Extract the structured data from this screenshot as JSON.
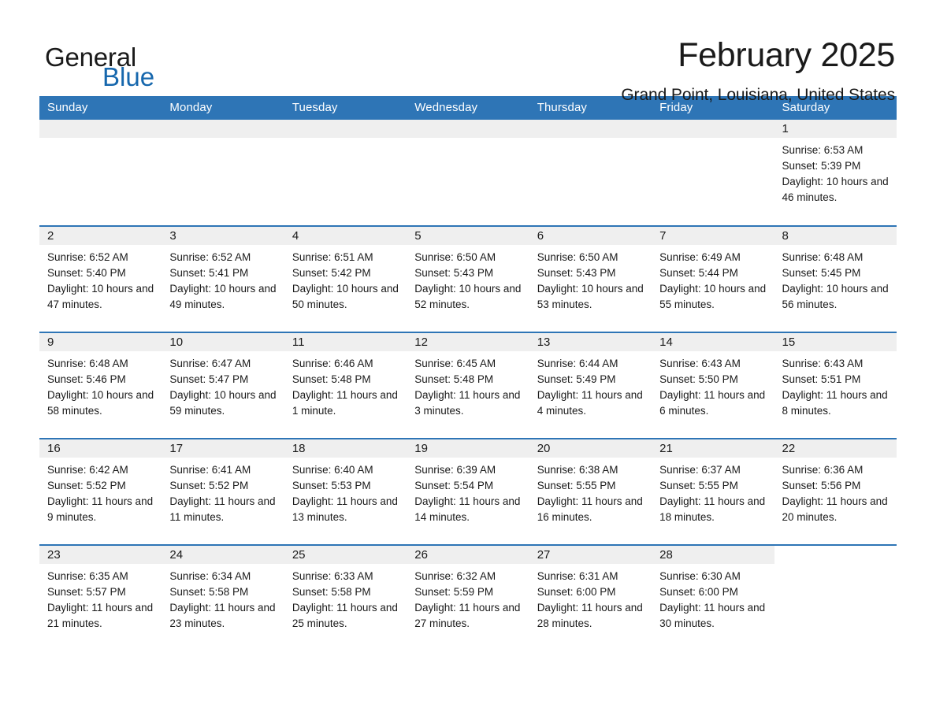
{
  "brand": {
    "name_part1": "General",
    "name_part2": "Blue",
    "logo_icon": "blue-triangle-flag",
    "color_black": "#1a1a1a",
    "color_blue": "#1667ad"
  },
  "header": {
    "title": "February 2025",
    "subtitle": "Grand Point, Louisiana, United States"
  },
  "theme": {
    "header_blue": "#2e75b6",
    "daynum_gray": "#efefef",
    "text": "#1a1a1a"
  },
  "weekday_headers": [
    "Sunday",
    "Monday",
    "Tuesday",
    "Wednesday",
    "Thursday",
    "Friday",
    "Saturday"
  ],
  "labels": {
    "sunrise_prefix": "Sunrise:",
    "sunset_prefix": "Sunset:",
    "daylight_prefix": "Daylight:"
  },
  "weeks": [
    [
      {
        "day": "",
        "blank": true
      },
      {
        "day": "",
        "blank": true
      },
      {
        "day": "",
        "blank": true
      },
      {
        "day": "",
        "blank": true
      },
      {
        "day": "",
        "blank": true
      },
      {
        "day": "",
        "blank": true
      },
      {
        "day": "1",
        "sunrise": "Sunrise: 6:53 AM",
        "sunset": "Sunset: 5:39 PM",
        "daylight": "Daylight: 10 hours and 46 minutes."
      }
    ],
    [
      {
        "day": "2",
        "sunrise": "Sunrise: 6:52 AM",
        "sunset": "Sunset: 5:40 PM",
        "daylight": "Daylight: 10 hours and 47 minutes."
      },
      {
        "day": "3",
        "sunrise": "Sunrise: 6:52 AM",
        "sunset": "Sunset: 5:41 PM",
        "daylight": "Daylight: 10 hours and 49 minutes."
      },
      {
        "day": "4",
        "sunrise": "Sunrise: 6:51 AM",
        "sunset": "Sunset: 5:42 PM",
        "daylight": "Daylight: 10 hours and 50 minutes."
      },
      {
        "day": "5",
        "sunrise": "Sunrise: 6:50 AM",
        "sunset": "Sunset: 5:43 PM",
        "daylight": "Daylight: 10 hours and 52 minutes."
      },
      {
        "day": "6",
        "sunrise": "Sunrise: 6:50 AM",
        "sunset": "Sunset: 5:43 PM",
        "daylight": "Daylight: 10 hours and 53 minutes."
      },
      {
        "day": "7",
        "sunrise": "Sunrise: 6:49 AM",
        "sunset": "Sunset: 5:44 PM",
        "daylight": "Daylight: 10 hours and 55 minutes."
      },
      {
        "day": "8",
        "sunrise": "Sunrise: 6:48 AM",
        "sunset": "Sunset: 5:45 PM",
        "daylight": "Daylight: 10 hours and 56 minutes."
      }
    ],
    [
      {
        "day": "9",
        "sunrise": "Sunrise: 6:48 AM",
        "sunset": "Sunset: 5:46 PM",
        "daylight": "Daylight: 10 hours and 58 minutes."
      },
      {
        "day": "10",
        "sunrise": "Sunrise: 6:47 AM",
        "sunset": "Sunset: 5:47 PM",
        "daylight": "Daylight: 10 hours and 59 minutes."
      },
      {
        "day": "11",
        "sunrise": "Sunrise: 6:46 AM",
        "sunset": "Sunset: 5:48 PM",
        "daylight": "Daylight: 11 hours and 1 minute."
      },
      {
        "day": "12",
        "sunrise": "Sunrise: 6:45 AM",
        "sunset": "Sunset: 5:48 PM",
        "daylight": "Daylight: 11 hours and 3 minutes."
      },
      {
        "day": "13",
        "sunrise": "Sunrise: 6:44 AM",
        "sunset": "Sunset: 5:49 PM",
        "daylight": "Daylight: 11 hours and 4 minutes."
      },
      {
        "day": "14",
        "sunrise": "Sunrise: 6:43 AM",
        "sunset": "Sunset: 5:50 PM",
        "daylight": "Daylight: 11 hours and 6 minutes."
      },
      {
        "day": "15",
        "sunrise": "Sunrise: 6:43 AM",
        "sunset": "Sunset: 5:51 PM",
        "daylight": "Daylight: 11 hours and 8 minutes."
      }
    ],
    [
      {
        "day": "16",
        "sunrise": "Sunrise: 6:42 AM",
        "sunset": "Sunset: 5:52 PM",
        "daylight": "Daylight: 11 hours and 9 minutes."
      },
      {
        "day": "17",
        "sunrise": "Sunrise: 6:41 AM",
        "sunset": "Sunset: 5:52 PM",
        "daylight": "Daylight: 11 hours and 11 minutes."
      },
      {
        "day": "18",
        "sunrise": "Sunrise: 6:40 AM",
        "sunset": "Sunset: 5:53 PM",
        "daylight": "Daylight: 11 hours and 13 minutes."
      },
      {
        "day": "19",
        "sunrise": "Sunrise: 6:39 AM",
        "sunset": "Sunset: 5:54 PM",
        "daylight": "Daylight: 11 hours and 14 minutes."
      },
      {
        "day": "20",
        "sunrise": "Sunrise: 6:38 AM",
        "sunset": "Sunset: 5:55 PM",
        "daylight": "Daylight: 11 hours and 16 minutes."
      },
      {
        "day": "21",
        "sunrise": "Sunrise: 6:37 AM",
        "sunset": "Sunset: 5:55 PM",
        "daylight": "Daylight: 11 hours and 18 minutes."
      },
      {
        "day": "22",
        "sunrise": "Sunrise: 6:36 AM",
        "sunset": "Sunset: 5:56 PM",
        "daylight": "Daylight: 11 hours and 20 minutes."
      }
    ],
    [
      {
        "day": "23",
        "sunrise": "Sunrise: 6:35 AM",
        "sunset": "Sunset: 5:57 PM",
        "daylight": "Daylight: 11 hours and 21 minutes."
      },
      {
        "day": "24",
        "sunrise": "Sunrise: 6:34 AM",
        "sunset": "Sunset: 5:58 PM",
        "daylight": "Daylight: 11 hours and 23 minutes."
      },
      {
        "day": "25",
        "sunrise": "Sunrise: 6:33 AM",
        "sunset": "Sunset: 5:58 PM",
        "daylight": "Daylight: 11 hours and 25 minutes."
      },
      {
        "day": "26",
        "sunrise": "Sunrise: 6:32 AM",
        "sunset": "Sunset: 5:59 PM",
        "daylight": "Daylight: 11 hours and 27 minutes."
      },
      {
        "day": "27",
        "sunrise": "Sunrise: 6:31 AM",
        "sunset": "Sunset: 6:00 PM",
        "daylight": "Daylight: 11 hours and 28 minutes."
      },
      {
        "day": "28",
        "sunrise": "Sunrise: 6:30 AM",
        "sunset": "Sunset: 6:00 PM",
        "daylight": "Daylight: 11 hours and 30 minutes."
      },
      {
        "day": "",
        "blank": true
      }
    ]
  ]
}
